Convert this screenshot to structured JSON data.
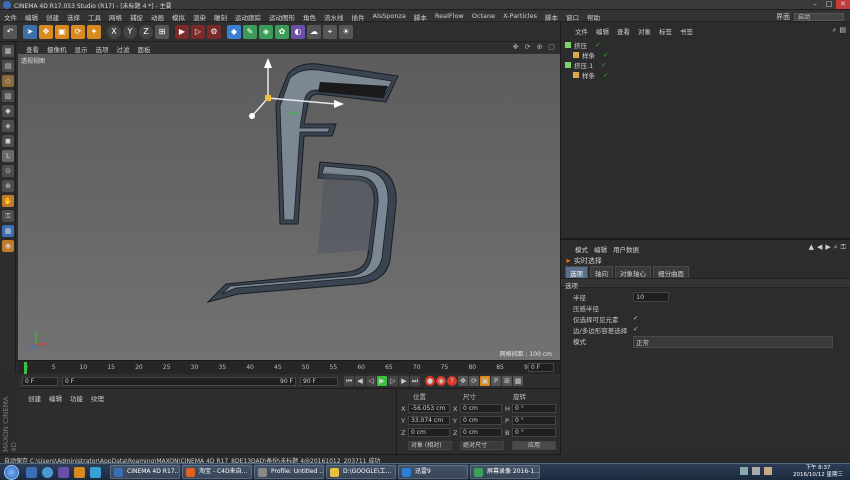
{
  "window": {
    "title": "CINEMA 4D R17.053 Studio (R17) - [未标题 4 *] - 主要",
    "controls": [
      "–",
      "□",
      "✕"
    ]
  },
  "menubar": {
    "items": [
      "文件",
      "编辑",
      "创建",
      "选择",
      "工具",
      "网格",
      "捕捉",
      "动画",
      "模拟",
      "渲染",
      "雕刻",
      "运动跟踪",
      "运动图形",
      "角色",
      "流水线",
      "插件",
      "AlsSponza",
      "脚本",
      "RealFlow",
      "Octane",
      "X-Particles",
      "脚本",
      "窗口",
      "帮助"
    ],
    "layout_label": "界面",
    "layout_value": "启动"
  },
  "toolbar": {
    "icons": [
      "undo-icon",
      "select-icon",
      "move-icon",
      "scale-icon",
      "rotate-icon",
      "recent-icon",
      "x-axis-icon",
      "y-axis-icon",
      "z-axis-icon",
      "coord-icon",
      "render-view-icon",
      "render-picture-icon",
      "render-settings-icon",
      "cube-icon",
      "pen-icon",
      "subdivision-icon",
      "array-icon",
      "deformer-icon",
      "scene-icon",
      "camera-icon",
      "light-icon"
    ],
    "axis_labels": [
      "X",
      "Y",
      "Z"
    ]
  },
  "viewport": {
    "menu": [
      "查看",
      "摄像机",
      "显示",
      "选项",
      "过滤",
      "面板"
    ],
    "label": "透视视图",
    "grid_spacing": "网格间距 : 100 cm"
  },
  "timeline": {
    "ticks": [
      "0",
      "5",
      "10",
      "15",
      "20",
      "25",
      "30",
      "35",
      "40",
      "45",
      "50",
      "55",
      "60",
      "65",
      "70",
      "75",
      "80",
      "85",
      "90"
    ],
    "current_frame": "0 F"
  },
  "transport": {
    "start_frame": "0 F",
    "range_start": "0 F",
    "range_end": "90 F",
    "end_frame": "90 F"
  },
  "material_manager": {
    "menu": [
      "创建",
      "编辑",
      "功能",
      "纹理"
    ]
  },
  "coordinates": {
    "headers": [
      "位置",
      "尺寸",
      "旋转"
    ],
    "rows": [
      {
        "axis": "X",
        "pos": "-56.053 cm",
        "size_axis": "X",
        "size": "0 cm",
        "rot_axis": "H",
        "rot": "0 °"
      },
      {
        "axis": "Y",
        "pos": "33.074 cm",
        "size_axis": "Y",
        "size": "0 cm",
        "rot_axis": "P",
        "rot": "0 °"
      },
      {
        "axis": "Z",
        "pos": "0 cm",
        "size_axis": "Z",
        "size": "0 cm",
        "rot_axis": "B",
        "rot": "0 °"
      }
    ],
    "mode_select": "对象 (相对)",
    "size_select": "绝对尺寸",
    "apply_button": "应用"
  },
  "status": "自动保存 C:\\Users\\Administrator\\AppData\\Roaming\\MAXON\\CINEMA 4D R17_8DE13DAD\\备份\\未标题 4@20161012_203711 成功",
  "object_manager": {
    "menu": [
      "文件",
      "编辑",
      "查看",
      "对象",
      "标签",
      "书签"
    ],
    "objects": [
      {
        "name": "挤压",
        "indent": 0,
        "color": "#7fd36b"
      },
      {
        "name": "样条",
        "indent": 1,
        "color": "#d9a94a"
      },
      {
        "name": "挤压.1",
        "indent": 0,
        "color": "#7fd36b"
      },
      {
        "name": "样条",
        "indent": 1,
        "color": "#d9a94a"
      }
    ]
  },
  "attribute_manager": {
    "menu": [
      "模式",
      "编辑",
      "用户数据"
    ],
    "title": "实时选择",
    "tabs": [
      "选项",
      "轴向",
      "对象轴心",
      "细分曲面"
    ],
    "section": "选项",
    "fields": [
      {
        "label": "半径",
        "value": "10"
      },
      {
        "label": "压感半径",
        "value": ""
      },
      {
        "label": "仅选择可见元素",
        "value": "✓"
      },
      {
        "label": "边/多边形容差选择",
        "value": "✓"
      },
      {
        "label": "模式",
        "value": "正常"
      }
    ]
  },
  "taskbar": {
    "buttons": [
      {
        "label": "CINEMA 4D R17...",
        "color": "#3b6fb5"
      },
      {
        "label": "淘宝 - C4D来自...",
        "color": "#e06020"
      },
      {
        "label": "Profile: Untitled ...",
        "color": "#888888"
      },
      {
        "label": "D:\\GOOGLE\\工...",
        "color": "#e8c040"
      },
      {
        "label": "迅雷9",
        "color": "#2a7fd4"
      },
      {
        "label": "屏幕录像 2016-1...",
        "color": "#3aa05a"
      }
    ],
    "clock_time": "下午 8:37",
    "clock_date": "2016/10/12 星期三"
  },
  "colors": {
    "accent": "#5a6f8a",
    "selection_orange": "#f07a20",
    "play_green": "#3cbf3c",
    "record_red": "#d83a2a"
  }
}
